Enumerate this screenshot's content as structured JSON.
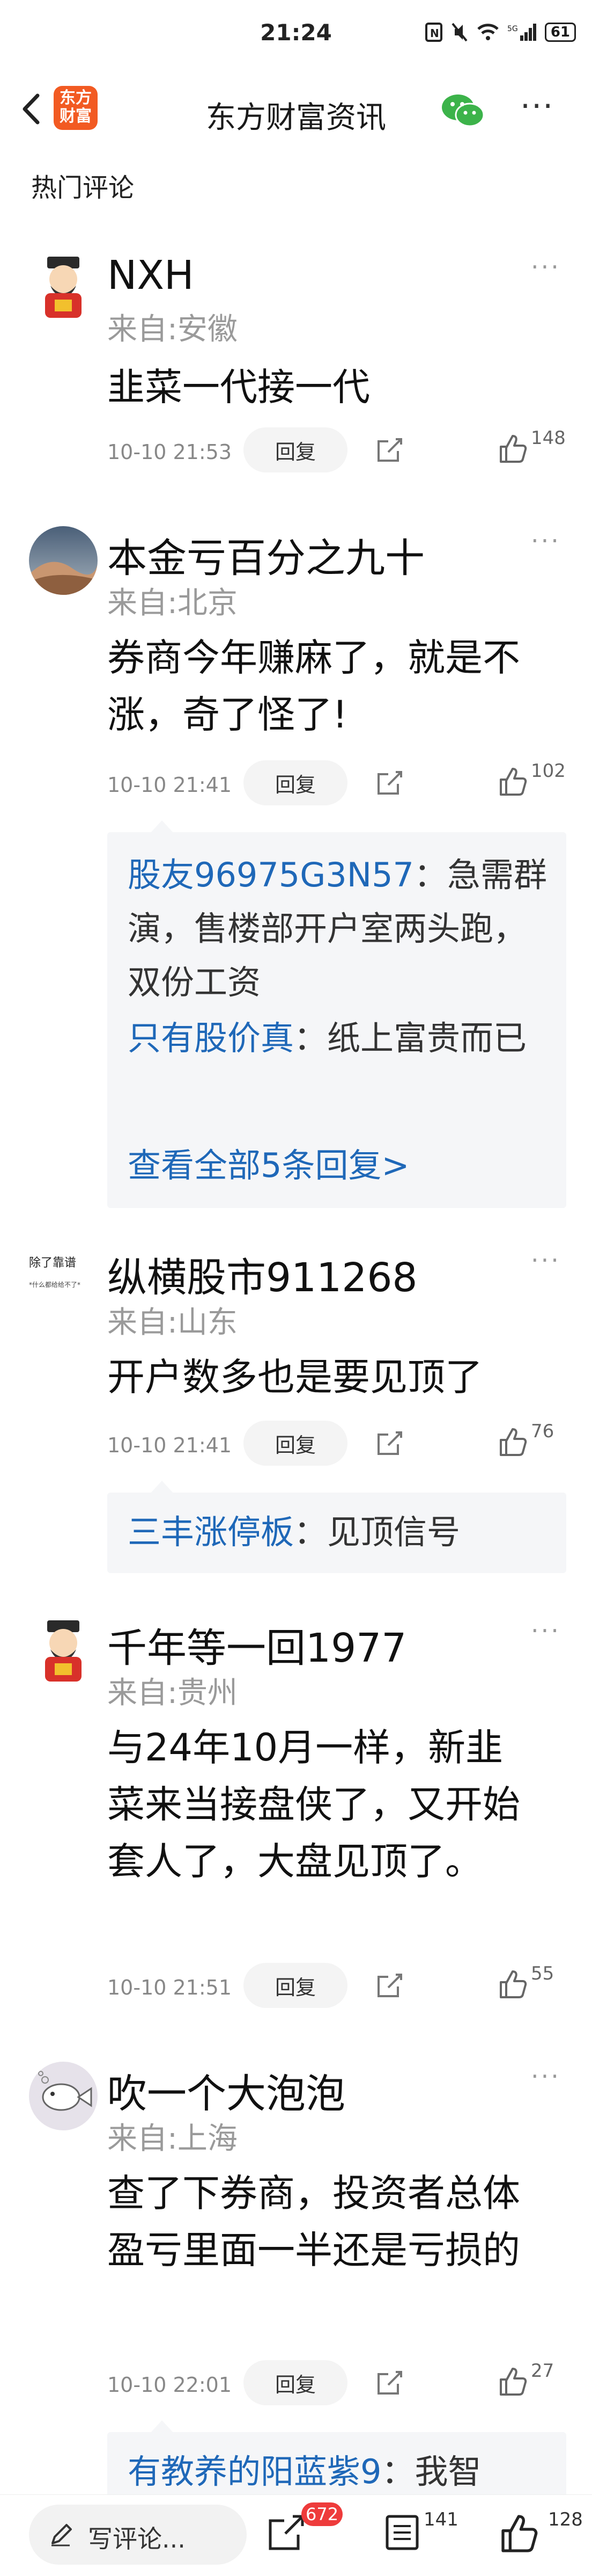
{
  "statusbar": {
    "time": "21:24",
    "battery": "61"
  },
  "header": {
    "logo_text": "东方\n财富",
    "title": "东方财富资讯",
    "more": "···"
  },
  "section_title": "热门评论",
  "comments": [
    {
      "name": "NXH",
      "location": "来自:安徽",
      "text": "韭菜一代接一代",
      "time": "10-10 21:53",
      "reply_label": "回复",
      "likes": "148"
    },
    {
      "name": "本金亏百分之九十",
      "location": "来自:北京",
      "text": "券商今年赚麻了，就是不涨，奇了怪了!",
      "time": "10-10 21:41",
      "reply_label": "回复",
      "likes": "102",
      "replies": [
        {
          "user": "股友96975G3N57",
          "content": "：急需群演，售楼部开户室两头跑，双份工资"
        },
        {
          "user": "只有股价真",
          "content": "：纸上富贵而已"
        }
      ],
      "view_all": "查看全部5条回复>"
    },
    {
      "name": "纵横股市911268",
      "location": "来自:山东",
      "text": "开户数多也是要见顶了",
      "time": "10-10 21:41",
      "reply_label": "回复",
      "likes": "76",
      "avatar_text": "除了靠谱",
      "avatar_subtext": "*什么都给给不了*",
      "replies": [
        {
          "user": "三丰涨停板",
          "content": "：见顶信号"
        }
      ]
    },
    {
      "name": "千年等一回1977",
      "location": "来自:贵州",
      "text": "与24年10月一样，新韭菜来当接盘侠了，又开始套人了，大盘见顶了。",
      "time": "10-10 21:51",
      "reply_label": "回复",
      "likes": "55"
    },
    {
      "name": "吹一个大泡泡",
      "location": "来自:上海",
      "text": "查了下券商，投资者总体盈亏里面一半还是亏损的",
      "time": "10-10 22:01",
      "reply_label": "回复",
      "likes": "27",
      "replies": [
        {
          "user": "有教养的阳蓝紫9",
          "content": "：我智"
        }
      ]
    }
  ],
  "bottombar": {
    "write_placeholder": "写评论...",
    "comment_count": "672",
    "list_count": "141",
    "like_count": "128"
  },
  "colors": {
    "link": "#1f68b8",
    "badge": "#ee3b3b",
    "logo": "#f25a22"
  }
}
